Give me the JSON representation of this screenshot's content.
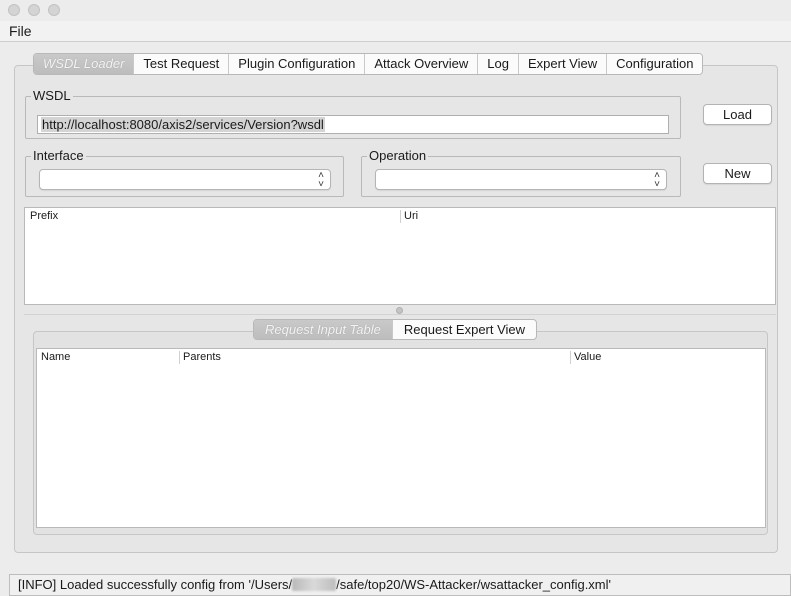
{
  "menubar": {
    "file": "File"
  },
  "tabs": [
    {
      "label": "WSDL Loader",
      "state": "selected"
    },
    {
      "label": "Test Request"
    },
    {
      "label": "Plugin Configuration"
    },
    {
      "label": "Attack Overview"
    },
    {
      "label": "Log"
    },
    {
      "label": "Expert View"
    },
    {
      "label": "Configuration"
    }
  ],
  "wsdl": {
    "title": "WSDL",
    "url": "http://localhost:8080/axis2/services/Version?wsdl",
    "load_label": "Load"
  },
  "interface": {
    "title": "Interface",
    "value": ""
  },
  "operation": {
    "title": "Operation",
    "value": ""
  },
  "new_label": "New",
  "namespace_table": {
    "columns": [
      "Prefix",
      "Uri"
    ]
  },
  "sub_tabs": [
    {
      "label": "Request Input Table",
      "state": "selected"
    },
    {
      "label": "Request Expert View"
    }
  ],
  "request_table": {
    "columns": [
      "Name",
      "Parents",
      "Value"
    ]
  },
  "status": {
    "prefix": "[INFO] Loaded successfully config from '/Users/",
    "suffix": "/safe/top20/WS-Attacker/wsattacker_config.xml'"
  }
}
